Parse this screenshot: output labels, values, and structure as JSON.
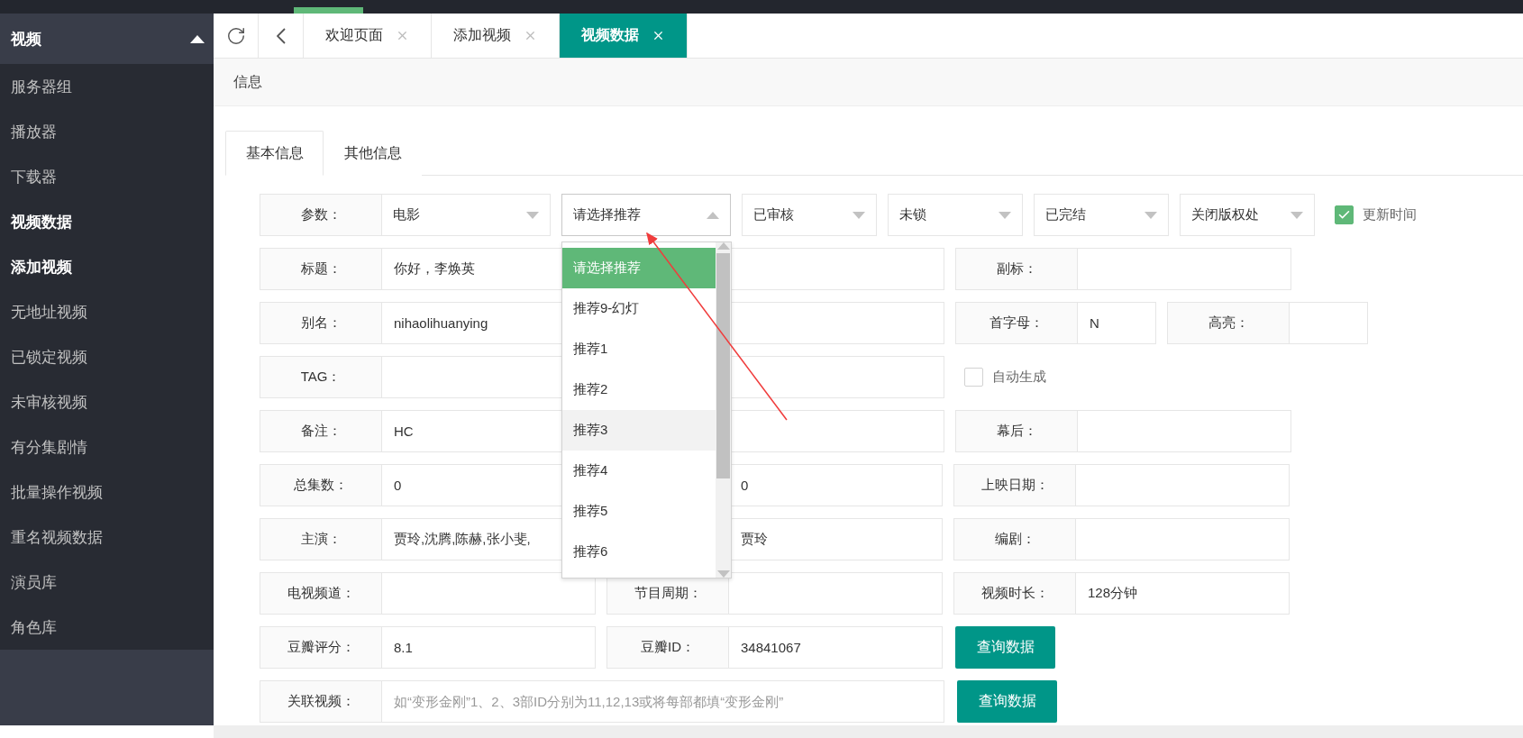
{
  "sidebar": {
    "header": {
      "label": "视频",
      "expanded": true
    },
    "items": [
      {
        "label": "服务器组",
        "active": false
      },
      {
        "label": "播放器",
        "active": false
      },
      {
        "label": "下载器",
        "active": false
      },
      {
        "label": "视频数据",
        "active": true
      },
      {
        "label": "添加视频",
        "active": true
      },
      {
        "label": "无地址视频",
        "active": false
      },
      {
        "label": "已锁定视频",
        "active": false
      },
      {
        "label": "未审核视频",
        "active": false
      },
      {
        "label": "有分集剧情",
        "active": false
      },
      {
        "label": "批量操作视频",
        "active": false
      },
      {
        "label": "重名视频数据",
        "active": false
      },
      {
        "label": "演员库",
        "active": false
      },
      {
        "label": "角色库",
        "active": false
      }
    ]
  },
  "tabs": [
    {
      "label": "欢迎页面",
      "selected": false
    },
    {
      "label": "添加视频",
      "selected": false
    },
    {
      "label": "视频数据",
      "selected": true
    }
  ],
  "breadcrumb": "信息",
  "form_tabs": [
    {
      "label": "基本信息",
      "selected": true
    },
    {
      "label": "其他信息",
      "selected": false
    }
  ],
  "rows": [
    {
      "items": [
        {
          "kind": "select",
          "label": "参数：",
          "value": "电影",
          "compact": false,
          "open": false
        },
        {
          "kind": "select",
          "value": "请选择推荐",
          "compact": false,
          "open": true,
          "options": [
            {
              "label": "请选择推荐",
              "selected": true,
              "hovered": false
            },
            {
              "label": "推荐9-幻灯",
              "selected": false,
              "hovered": false
            },
            {
              "label": "推荐1",
              "selected": false,
              "hovered": false
            },
            {
              "label": "推荐2",
              "selected": false,
              "hovered": false
            },
            {
              "label": "推荐3",
              "selected": false,
              "hovered": true
            },
            {
              "label": "推荐4",
              "selected": false,
              "hovered": false
            },
            {
              "label": "推荐5",
              "selected": false,
              "hovered": false
            },
            {
              "label": "推荐6",
              "selected": false,
              "hovered": false
            }
          ]
        },
        {
          "kind": "select",
          "value": "已审核",
          "compact": true,
          "open": false
        },
        {
          "kind": "select",
          "value": "未锁",
          "compact": true,
          "open": false
        },
        {
          "kind": "select",
          "value": "已完结",
          "compact": true,
          "open": false
        },
        {
          "kind": "select",
          "value": "关闭版权处",
          "compact": true,
          "open": false
        },
        {
          "kind": "checkbox",
          "label": "更新时间",
          "checked": true
        }
      ]
    },
    {
      "items": [
        {
          "kind": "field",
          "label": "标题：",
          "value": "你好，李焕英",
          "wide": true
        },
        {
          "kind": "field",
          "label": "副标："
        }
      ]
    },
    {
      "items": [
        {
          "kind": "field",
          "label": "别名：",
          "value": "nihaolihuanying",
          "wide": true
        },
        {
          "kind": "field",
          "label": "首字母：",
          "value": "N",
          "short": true
        },
        {
          "kind": "field",
          "label": "高亮：",
          "short": true
        }
      ]
    },
    {
      "items": [
        {
          "kind": "field",
          "label": "TAG：",
          "wide": true
        },
        {
          "kind": "checkbox",
          "label": "自动生成",
          "checked": false
        }
      ]
    },
    {
      "items": [
        {
          "kind": "field",
          "label": "备注：",
          "value": "HC",
          "wide": true
        },
        {
          "kind": "field",
          "label": "幕后："
        }
      ]
    },
    {
      "items": [
        {
          "kind": "field",
          "label": "总集数：",
          "value": "0"
        },
        {
          "kind": "field",
          "value": "0"
        },
        {
          "kind": "field",
          "label": "上映日期："
        }
      ]
    },
    {
      "items": [
        {
          "kind": "field",
          "label": "主演：",
          "value": "贾玲,沈腾,陈赫,张小斐,"
        },
        {
          "kind": "field",
          "value": "贾玲"
        },
        {
          "kind": "field",
          "label": "编剧："
        }
      ]
    },
    {
      "items": [
        {
          "kind": "field",
          "label": "电视频道："
        },
        {
          "kind": "field",
          "label": "节目周期："
        },
        {
          "kind": "field",
          "label": "视频时长：",
          "value": "128分钟"
        }
      ]
    },
    {
      "items": [
        {
          "kind": "field",
          "label": "豆瓣评分：",
          "value": "8.1"
        },
        {
          "kind": "field",
          "label": "豆瓣ID：",
          "value": "34841067"
        },
        {
          "kind": "button",
          "label": "查询数据"
        }
      ]
    },
    {
      "items": [
        {
          "kind": "field",
          "label": "关联视频：",
          "placeholder": "如“变形金刚”1、2、3部ID分别为11,12,13或将每部都填“变形金刚”",
          "wide": true
        },
        {
          "kind": "button",
          "label": "查询数据"
        }
      ]
    }
  ]
}
